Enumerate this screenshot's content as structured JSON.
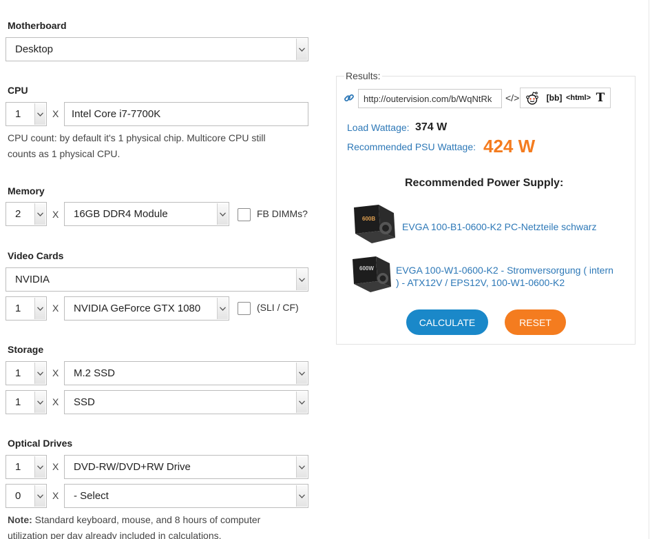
{
  "motherboard": {
    "label": "Motherboard",
    "value": "Desktop"
  },
  "cpu": {
    "label": "CPU",
    "count": "1",
    "times": "X",
    "model": "Intel Core i7-7700K",
    "note_line1": "CPU count: by default it's 1 physical chip. Multicore CPU still",
    "note_line2": "counts as 1 physical CPU."
  },
  "memory": {
    "label": "Memory",
    "count": "2",
    "times": "X",
    "module": "16GB DDR4 Module",
    "fb_dimms_label": "FB DIMMs?"
  },
  "video": {
    "label": "Video Cards",
    "brand": "NVIDIA",
    "count": "1",
    "times": "X",
    "model": "NVIDIA GeForce GTX 1080",
    "sli_label": "(SLI / CF)"
  },
  "storage": {
    "label": "Storage",
    "rows": [
      {
        "count": "1",
        "times": "X",
        "type": "M.2 SSD"
      },
      {
        "count": "1",
        "times": "X",
        "type": "SSD"
      }
    ]
  },
  "optical": {
    "label": "Optical Drives",
    "rows": [
      {
        "count": "1",
        "times": "X",
        "type": "DVD-RW/DVD+RW Drive"
      },
      {
        "count": "0",
        "times": "X",
        "type": "- Select"
      }
    ]
  },
  "note": {
    "bold": "Note:",
    "line1": " Standard keyboard, mouse, and 8 hours of computer",
    "line2": "utilization per day already included in calculations."
  },
  "results": {
    "legend": "Results:",
    "share_url": "http://outervision.com/b/WqNtRk",
    "code_glyph": "</>",
    "share_buttons": {
      "bb": "[bb]",
      "html": "<html>",
      "text": "T"
    },
    "load_label": "Load Wattage:",
    "load_value": "374 W",
    "psu_label": "Recommended PSU Wattage:",
    "psu_value": "424 W",
    "rec_heading": "Recommended Power Supply:",
    "supplies": [
      {
        "name": "EVGA 100-B1-0600-K2 PC-Netzteile schwarz",
        "box_text": "600B"
      },
      {
        "name_line1": "EVGA 100-W1-0600-K2 - Stromversorgung ( intern",
        "name_line2": ") - ATX12V / EPS12V, 100-W1-0600-K2",
        "box_text": "600W"
      }
    ],
    "calculate_label": "CALCULATE",
    "reset_label": "RESET"
  },
  "colors": {
    "link": "#2d78b7",
    "accent_orange": "#f47c1f",
    "accent_blue": "#1a88c9"
  },
  "icons": {
    "link": "link-icon",
    "reddit": "reddit-icon",
    "dropdown": "chevron-down-icon"
  }
}
